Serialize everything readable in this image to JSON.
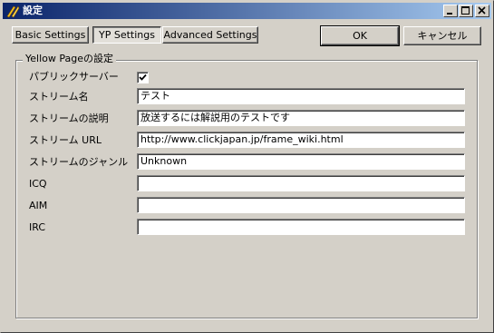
{
  "window": {
    "title": "設定"
  },
  "tabs": [
    {
      "label": "Basic Settings",
      "selected": false
    },
    {
      "label": "YP Settings",
      "selected": true
    },
    {
      "label": "Advanced Settings",
      "selected": false
    }
  ],
  "actions": {
    "ok_label": "OK",
    "cancel_label": "キャンセル"
  },
  "yellow_page": {
    "group_title": "Yellow Pageの設定",
    "public_server": {
      "label": "パブリックサーバー",
      "checked": true
    },
    "fields": [
      {
        "label": "ストリーム名",
        "value": "テスト"
      },
      {
        "label": "ストリームの説明",
        "value": "放送するには解説用のテストです"
      },
      {
        "label": "ストリーム URL",
        "value": "http://www.clickjapan.jp/frame_wiki.html"
      },
      {
        "label": "ストリームのジャンル",
        "value": "Unknown"
      },
      {
        "label": "ICQ",
        "value": ""
      },
      {
        "label": "AIM",
        "value": ""
      },
      {
        "label": "IRC",
        "value": ""
      }
    ]
  },
  "colors": {
    "titlebar_start": "#0a246a",
    "titlebar_end": "#a6caf0",
    "face": "#d4d0c8"
  },
  "icons": [
    "app-icon",
    "minimize-icon",
    "maximize-icon",
    "close-icon",
    "checkmark-icon"
  ]
}
